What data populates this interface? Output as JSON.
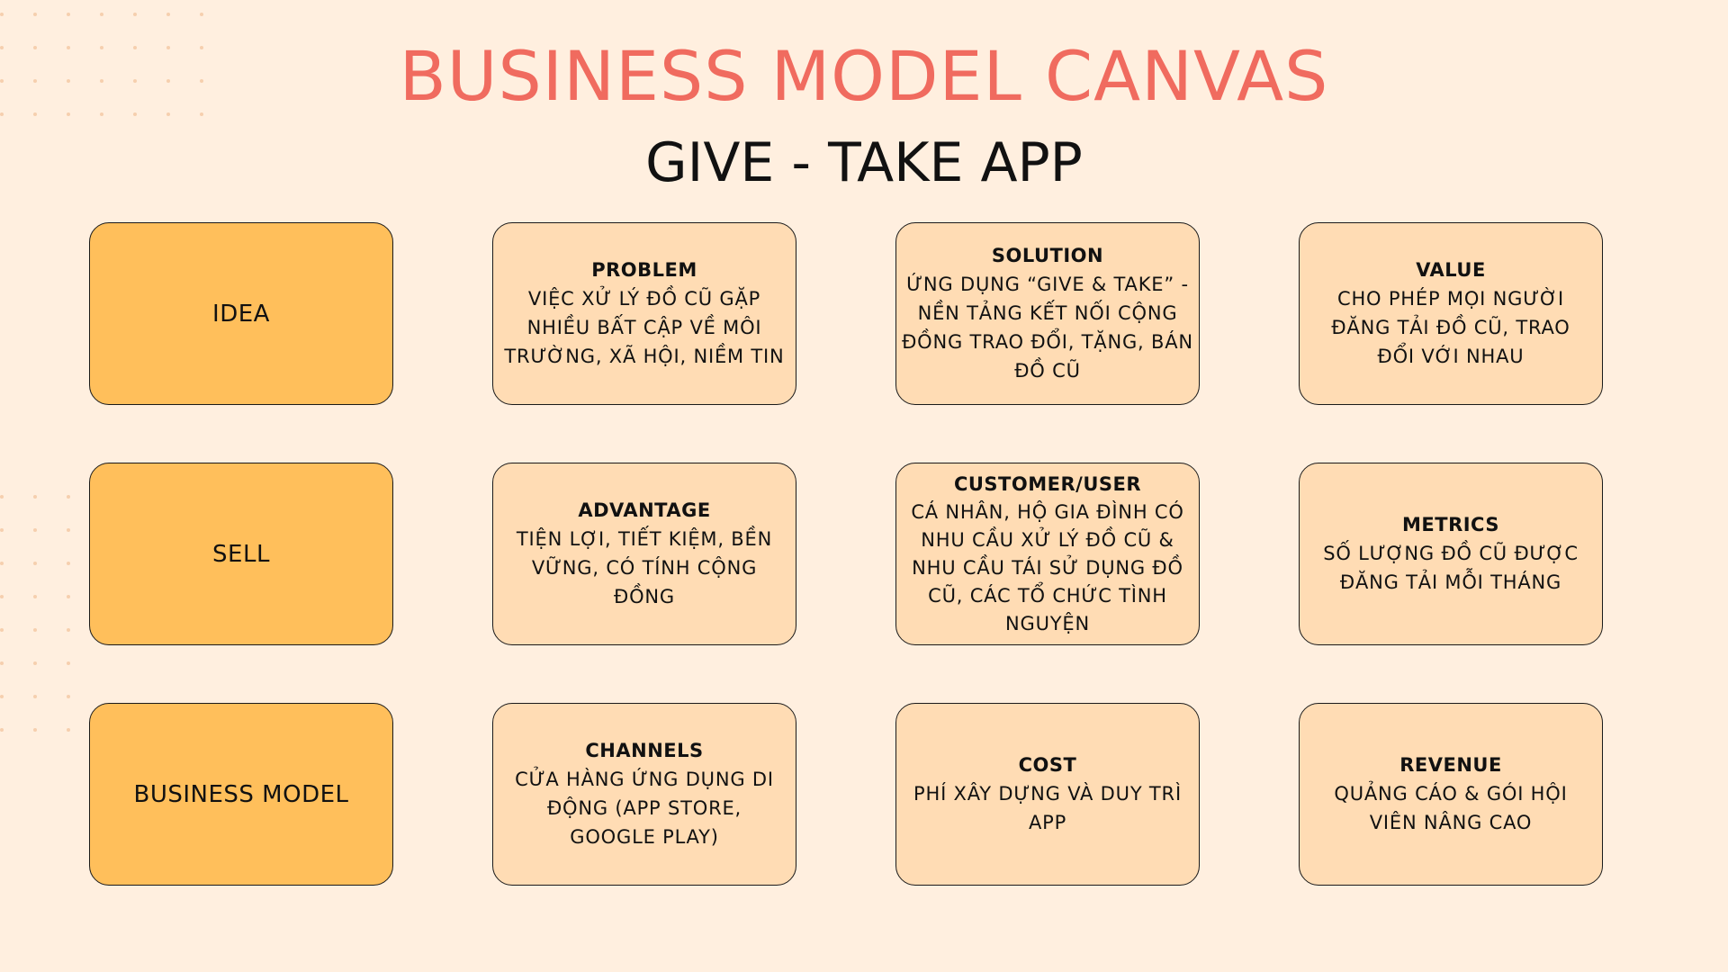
{
  "title": "BUSINESS MODEL CANVAS",
  "subtitle": "GIVE - TAKE APP",
  "colors": {
    "background": "#ffefdf",
    "title": "#f06b5f",
    "category_fill": "#ffbf5b",
    "card_fill": "#ffdcb4",
    "border": "#1a1a1a"
  },
  "rows": [
    {
      "category": "IDEA",
      "cells": [
        {
          "heading": "PROBLEM",
          "body": "VIỆC XỬ LÝ ĐỒ CŨ GẶP NHIỀU BẤT CẬP VỀ MÔI TRƯỜNG, XÃ HỘI, NIỀM TIN"
        },
        {
          "heading": "SOLUTION",
          "body": "ỨNG DỤNG “GIVE & TAKE” - NỀN TẢNG KẾT NỐI CỘNG ĐỒNG TRAO ĐỔI, TẶNG, BÁN ĐỒ CŨ"
        },
        {
          "heading": "VALUE",
          "body": "CHO PHÉP MỌI NGƯỜI ĐĂNG TẢI ĐỒ CŨ, TRAO ĐỔI VỚI NHAU"
        }
      ]
    },
    {
      "category": "SELL",
      "cells": [
        {
          "heading": "ADVANTAGE",
          "body": "TIỆN LỢI, TIẾT KIỆM, BỀN VỮNG, CÓ TÍNH CỘNG ĐỒNG"
        },
        {
          "heading": "CUSTOMER/USER",
          "body": "CÁ NHÂN, HỘ GIA ĐÌNH CÓ NHU CẦU XỬ LÝ ĐỒ CŨ & NHU CẦU TÁI SỬ DỤNG ĐỒ CŨ, CÁC TỔ CHỨC TÌNH NGUYỆN"
        },
        {
          "heading": "METRICS",
          "body": "SỐ LƯỢNG ĐỒ CŨ ĐƯỢC ĐĂNG TẢI MỖI THÁNG"
        }
      ]
    },
    {
      "category": "BUSINESS MODEL",
      "cells": [
        {
          "heading": "CHANNELS",
          "body": "CỬA HÀNG ỨNG DỤNG DI ĐỘNG (APP STORE, GOOGLE PLAY)"
        },
        {
          "heading": "COST",
          "body": "PHÍ XÂY DỰNG VÀ DUY TRÌ APP"
        },
        {
          "heading": "REVENUE",
          "body": "QUẢNG CÁO & GÓI HỘI VIÊN NÂNG CAO"
        }
      ]
    }
  ]
}
